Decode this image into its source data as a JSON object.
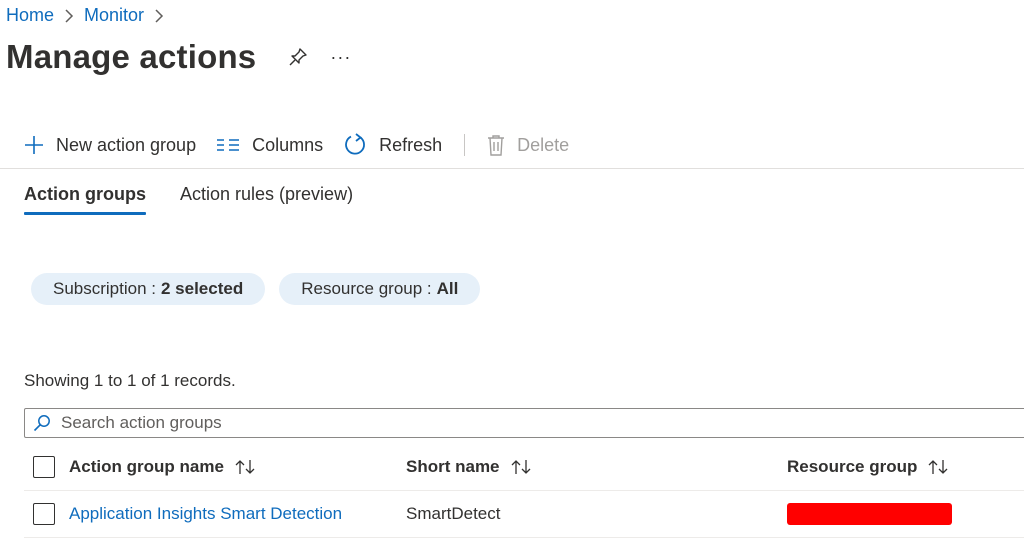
{
  "breadcrumb": {
    "items": [
      {
        "label": "Home"
      },
      {
        "label": "Monitor"
      }
    ]
  },
  "page": {
    "title": "Manage actions",
    "pin_icon": "pin-icon",
    "more_icon": "more-icon",
    "more_label": "···"
  },
  "toolbar": {
    "new_action_group": "New action group",
    "columns": "Columns",
    "refresh": "Refresh",
    "delete": "Delete"
  },
  "tabs": [
    {
      "label": "Action groups",
      "active": true
    },
    {
      "label": "Action rules (preview)",
      "active": false
    }
  ],
  "filters": {
    "subscription": {
      "label": "Subscription :",
      "value": "2 selected"
    },
    "resource_group": {
      "label": "Resource group :",
      "value": "All"
    }
  },
  "records_text": "Showing 1 to 1 of 1 records.",
  "search": {
    "placeholder": "Search action groups",
    "value": ""
  },
  "table": {
    "columns": [
      "Action group name",
      "Short name",
      "Resource group"
    ],
    "rows": [
      {
        "name": "Application Insights Smart Detection",
        "short_name": "SmartDetect",
        "resource_group_redacted": true
      }
    ]
  },
  "colors": {
    "accent": "#0f6cbd",
    "pill_bg": "#e6f0f9",
    "redaction": "#ff0000",
    "disabled": "#a19f9d"
  }
}
